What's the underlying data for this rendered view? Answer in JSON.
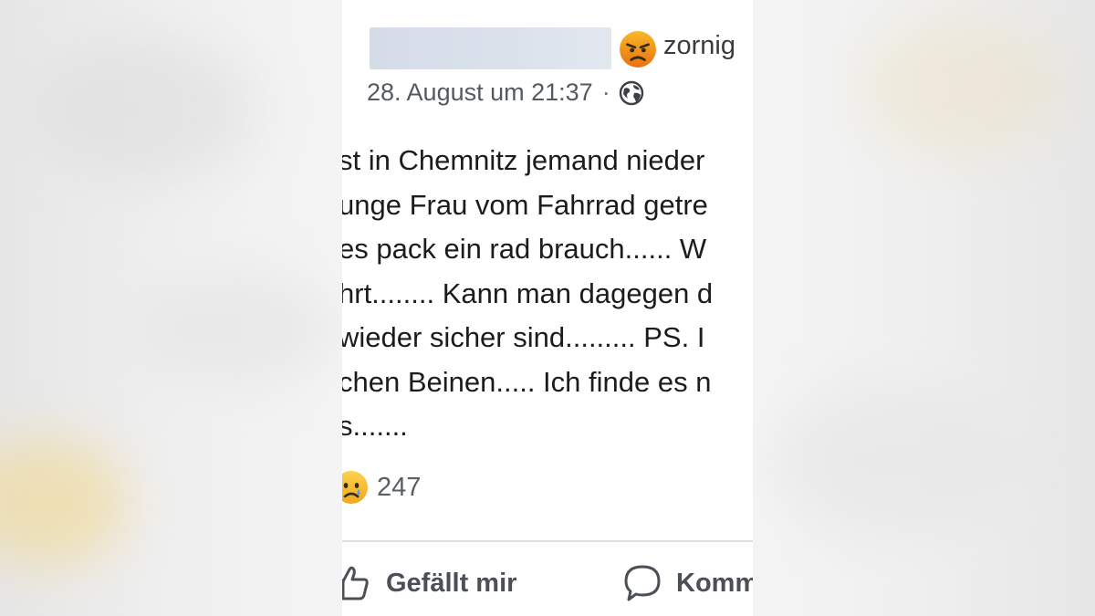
{
  "post": {
    "author": "",
    "feeling": "zornig",
    "feeling_icon": "angry-face-icon",
    "timestamp": "28. August um 21:37",
    "separator": "·",
    "privacy_icon": "globe-icon",
    "body_lines": [
      "st in Chemnitz jemand nieder",
      "unge Frau vom Fahrrad getre",
      "es pack ein rad brauch...... W",
      "hrt........ Kann man dagegen d",
      "wieder sicher sind......... PS. I",
      "chen Beinen..... Ich finde es n",
      "s......."
    ],
    "reaction_count": "247",
    "actions": {
      "like_label": "Gefällt mir",
      "comment_label": "Komm"
    }
  },
  "colors": {
    "card_background": "#ffffff",
    "outside_background": "#ededed",
    "redaction": "#d8dfea",
    "angry_emoji_top": "#f7b928",
    "angry_emoji_bottom": "#e9710f"
  }
}
